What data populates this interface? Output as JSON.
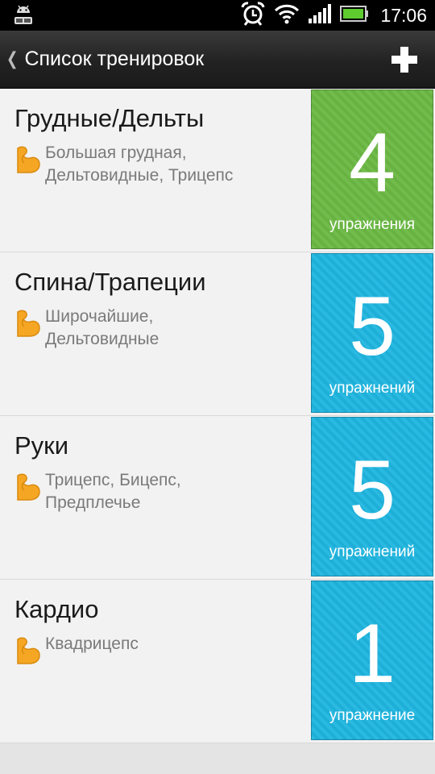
{
  "status_bar": {
    "time": "17:06",
    "icons": [
      "android-robot-toggle-icon",
      "alarm-icon",
      "wifi-icon",
      "signal-icon",
      "battery-icon"
    ]
  },
  "title_bar": {
    "title": "Список тренировок",
    "back_icon": "chevron-left-icon",
    "add_icon": "plus-icon"
  },
  "colors": {
    "green_tile": "#6ab843",
    "blue_tile": "#1fb5df",
    "muscle_icon": "#f5a623"
  },
  "workouts": [
    {
      "name": "Грудные/Дельты",
      "muscles": "Большая грудная,\nДельтовидные, Трицепс",
      "count": "4",
      "count_label": "упражнения",
      "color": "green"
    },
    {
      "name": "Спина/Трапеции",
      "muscles": "Широчайшие,\nДельтовидные",
      "count": "5",
      "count_label": "упражнений",
      "color": "blue"
    },
    {
      "name": "Руки",
      "muscles": "Трицепс, Бицепс,\nПредплечье",
      "count": "5",
      "count_label": "упражнений",
      "color": "blue"
    },
    {
      "name": "Кардио",
      "muscles": "Квадрицепс",
      "count": "1",
      "count_label": "упражнение",
      "color": "blue"
    }
  ]
}
